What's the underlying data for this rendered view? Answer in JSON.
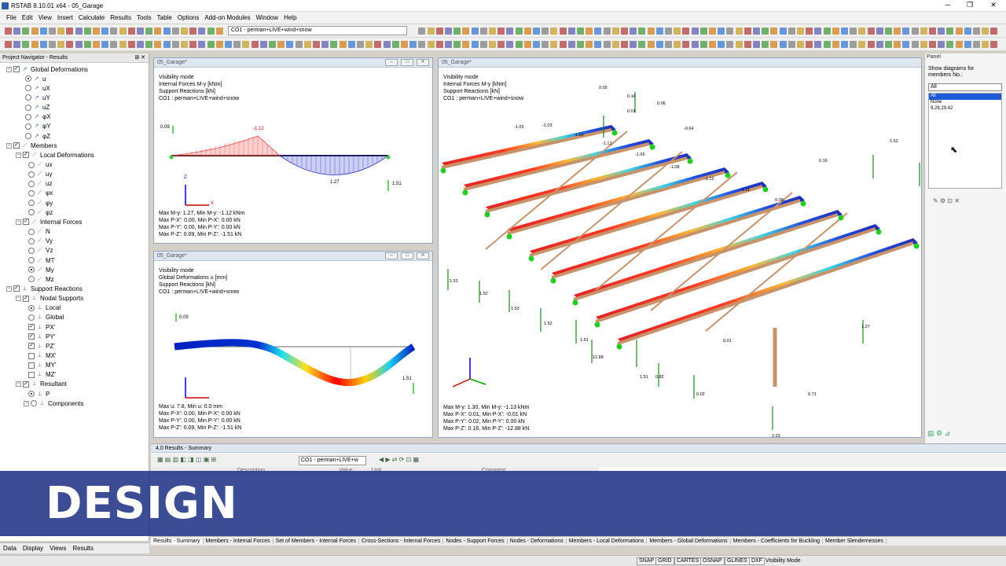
{
  "app": {
    "title": "RSTAB 8.10.01 x64 - 05_Garage"
  },
  "menu": [
    "File",
    "Edit",
    "View",
    "Insert",
    "Calculate",
    "Results",
    "Tools",
    "Table",
    "Options",
    "Add-on Modules",
    "Window",
    "Help"
  ],
  "toolbar": {
    "load_combo": "CO1 - perman+LIVE+wind+snow"
  },
  "navigator": {
    "title": "Project Navigator - Results",
    "items": [
      "Global Deformations",
      "u",
      "uX",
      "uY",
      "uZ",
      "φX",
      "φY",
      "φZ",
      "Members",
      "Local Deformations",
      "ux",
      "uy",
      "uz",
      "φx",
      "φy",
      "φz",
      "Internal Forces",
      "N",
      "Vy",
      "Vz",
      "MT",
      "My",
      "Mz",
      "Support Reactions",
      "Nodal Supports",
      "Local",
      "Global",
      "PX'",
      "PY'",
      "PZ'",
      "MX'",
      "MY'",
      "MZ'",
      "Resultant",
      "P",
      "Components"
    ],
    "tabs": [
      "Data",
      "Display",
      "Views",
      "Results"
    ]
  },
  "win1": {
    "title": "05_Garage*",
    "info": "Visibility mode\nInternal Forces M-y [kNm]\nSupport Reactions [kN]\nCO1 : perman+LIVE+wind+snow",
    "maxinfo": "Max M-y: 1.27, Min M-y: -1.12 kNm\nMax P-X': 0.00, Min P-X': 0.00 kN\nMax P-Y': 0.00, Min P-Y': 0.00 kN\nMax P-Z': 0.09, Min P-Z': -1.51 kN",
    "labels": [
      "0.09",
      "-1.12",
      "1.27",
      "1.51",
      "Z",
      "X"
    ]
  },
  "win2": {
    "title": "05_Garage*",
    "info": "Visibility mode\nGlobal Deformations u [mm]\nSupport Reactions [kN]\nCO1 : perman+LIVE+wind+snow",
    "maxinfo": "Max u: 7.8, Min u: 0.0 mm\nMax P-X': 0.00, Min P-X': 0.00 kN\nMax P-Y': 0.00, Min P-Y': 0.00 kN\nMax P-Z': 0.09, Min P-Z': -1.51 kN",
    "labels": [
      "0.09",
      "1.51"
    ]
  },
  "win3": {
    "title": "05_Garage*",
    "info": "Visibility mode\nInternal Forces M-y [kNm]\nSupport Reactions [kN]\nCO1 : perman+LIVE+wind+snow",
    "maxinfo": "Max M-y: 1.30, Min M-y: -1.13 kNm\nMax P-X': 0.01, Min P-X': -0.01 kN\nMax P-Y': 0.02, Min P-Y': 0.00 kN\nMax P-Z': 0.16, Min P-Z': -12.88 kN",
    "labels": [
      "0.05",
      "0.14",
      "0.06",
      "0.01",
      "-0.64",
      "-1.05",
      "-1.03",
      "-1.00",
      "-1.13",
      "-1.06",
      "-1.08",
      "-1.12",
      "-1.11",
      "0.09",
      "0.16",
      "1.52",
      "1.51",
      "1.52",
      "1.53",
      "1.52",
      "1.51",
      "12.88",
      "1.51",
      "0.82",
      "0.02",
      "0.71",
      "2.03",
      "1.27",
      "0.01"
    ]
  },
  "panel": {
    "title": "Panel",
    "label": "Show diagrams for members No.:",
    "input": "All",
    "options": [
      "All",
      "None",
      "9,28,29,42"
    ]
  },
  "results": {
    "title": "4.0 Results - Summary",
    "combo": "CO1 - perman+LIVE+w",
    "cols": [
      "Description",
      "Value",
      "Unit",
      "Comment"
    ]
  },
  "result_tabs": [
    "Results - Summary",
    "Members - Internal Forces",
    "Set of Members - Internal Forces",
    "Cross-Sections - Internal Forces",
    "Nodes - Support Forces",
    "Nodes - Deformations",
    "Members - Local Deformations",
    "Members - Global Deformations",
    "Members - Coefficients for Buckling",
    "Member Slendernesses"
  ],
  "status": [
    "SNAP",
    "GRID",
    "CARTES",
    "OSNAP",
    "GLINES",
    "DXF",
    "Visibility Mode"
  ],
  "banner": "DESIGN"
}
